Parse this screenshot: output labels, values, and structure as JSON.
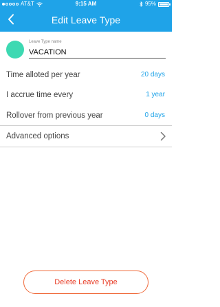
{
  "status_bar": {
    "carrier": "AT&T",
    "time": "9:15 AM",
    "battery": "95%",
    "wifi_icon": "wifi-icon",
    "bluetooth_icon": "bluetooth-icon"
  },
  "nav": {
    "title": "Edit Leave Type",
    "back_icon": "chevron-left-icon"
  },
  "leave_type": {
    "name_label": "Leave Type name",
    "name_value": "VACATION",
    "color": "#3dd9b2"
  },
  "settings": [
    {
      "label": "Time alloted per year",
      "value": "20 days"
    },
    {
      "label": "I accrue time every",
      "value": "1 year"
    },
    {
      "label": "Rollover from previous year",
      "value": "0 days"
    }
  ],
  "advanced": {
    "label": "Advanced options",
    "icon": "chevron-right-icon"
  },
  "delete_button": {
    "label": "Delete Leave Type"
  },
  "colors": {
    "header": "#1fa3e8",
    "accent_value": "#1fa3e8",
    "delete": "#e8402a"
  }
}
